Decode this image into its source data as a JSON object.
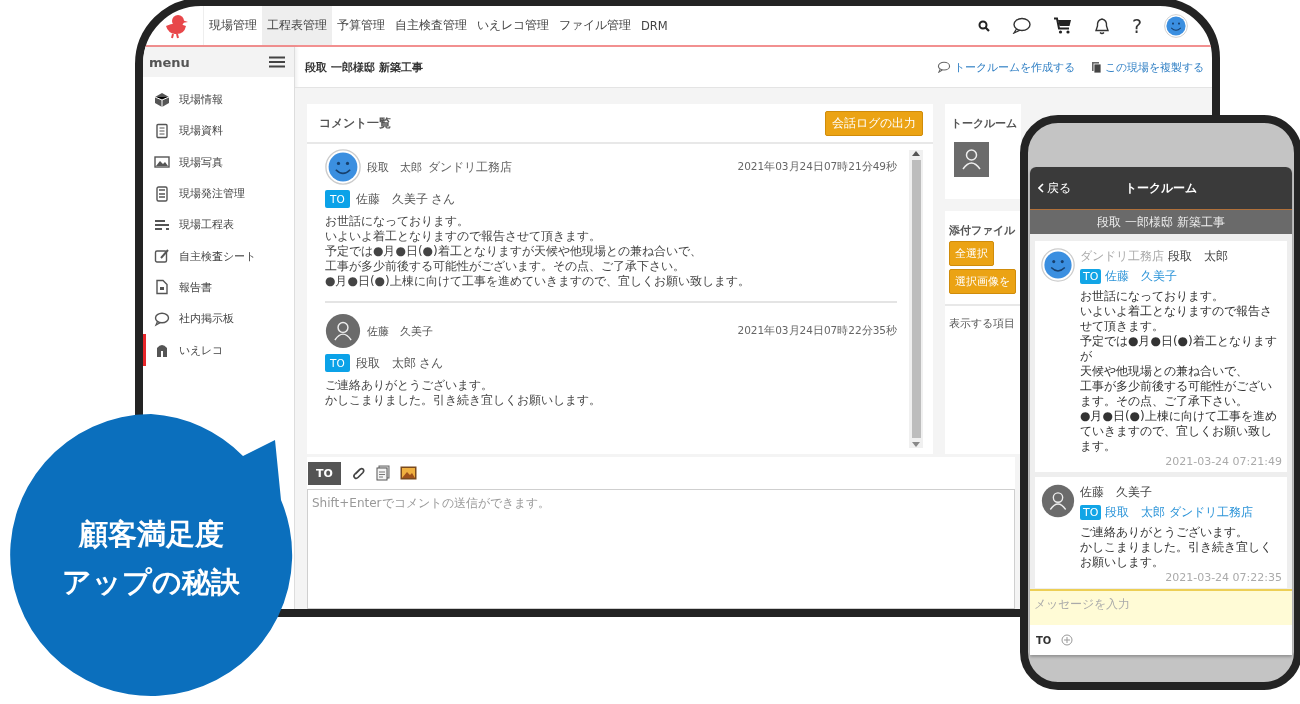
{
  "nav": {
    "items": [
      {
        "label": "現場管理",
        "selected": false
      },
      {
        "label": "工程表管理",
        "selected": true
      },
      {
        "label": "予算管理",
        "selected": false
      },
      {
        "label": "自主検査管理",
        "selected": false
      },
      {
        "label": "いえレコ管理",
        "selected": false
      },
      {
        "label": "ファイル管理",
        "selected": false
      },
      {
        "label": "DRM",
        "selected": false
      }
    ],
    "help": "?"
  },
  "sidebar": {
    "title": "menu",
    "items": [
      {
        "label": "現場情報",
        "selected": false
      },
      {
        "label": "現場資料",
        "selected": false
      },
      {
        "label": "現場写真",
        "selected": false
      },
      {
        "label": "現場発注管理",
        "selected": false
      },
      {
        "label": "現場工程表",
        "selected": false
      },
      {
        "label": "自主検査シート",
        "selected": false
      },
      {
        "label": "報告書",
        "selected": false
      },
      {
        "label": "社内掲示板",
        "selected": false
      },
      {
        "label": "いえレコ",
        "selected": true
      }
    ]
  },
  "page": {
    "title": "段取 一郎様邸 新築工事",
    "actions": [
      "トークルームを作成する",
      "この現場を複製する"
    ]
  },
  "comments": {
    "title": "コメント一覧",
    "export_button": "会話ログの出力",
    "items": [
      {
        "kind": "custom_avatar",
        "author": "段取　太郎",
        "company": "ダンドリ工務店",
        "date": "2021年03月24日07時21分49秒",
        "to_badge": "TO",
        "recipient": "佐藤　久美子 さん",
        "lines": [
          "お世話になっております。",
          "いよいよ着工となりますので報告させて頂きます。",
          "予定では●月●日(●)着工となりますが天候や他現場との兼ね合いで、",
          "工事が多少前後する可能性がございます。その点、ご了承下さい。",
          "●月●日(●)上棟に向けて工事を進めていきますので、宜しくお願い致します。"
        ]
      },
      {
        "kind": "default_avatar",
        "author": "佐藤　久美子",
        "date": "2021年03月24日07時22分35秒",
        "to_badge": "TO",
        "recipient": "段取　太郎 さん",
        "lines": [
          "ご連絡ありがとうございます。",
          "かしこまりました。引き続き宜しくお願いします。"
        ]
      }
    ]
  },
  "side_panel": {
    "members_title": "トークルーム",
    "files_title": "添付ファイル",
    "buttons": [
      "全選択",
      "選択画像を"
    ],
    "display_label": "表示する項目"
  },
  "composer": {
    "to_button": "TO",
    "placeholder": "Shift+Enterでコメントの送信ができます。"
  },
  "phone": {
    "back": "戻る",
    "title": "トークルーム",
    "subtitle": "段取 一郎様邸 新築工事",
    "messages": [
      {
        "kind": "custom_avatar",
        "company": "ダンドリ工務店",
        "author": "段取　太郎",
        "to_badge": "TO",
        "recipient": "佐藤　久美子",
        "lines": [
          "お世話になっております。",
          "いよいよ着工となりますので報告させて頂きます。",
          "予定では●月●日(●)着工となりますが",
          "天候や他現場との兼ね合いで、",
          "工事が多少前後する可能性がございます。その点、ご了承下さい。",
          "●月●日(●)上棟に向けて工事を進めていきますので、宜しくお願い致します。"
        ],
        "time": "2021-03-24 07:21:49"
      },
      {
        "kind": "default_avatar",
        "author": "佐藤　久美子",
        "to_badge": "TO",
        "recipient": "段取　太郎",
        "recipient_company": "ダンドリ工務店",
        "lines": [
          "ご連絡ありがとうございます。",
          "かしこまりました。引き続き宜しくお願いします。"
        ],
        "time": "2021-03-24 07:22:35"
      }
    ],
    "placeholder": "メッセージを入力",
    "to_label": "TO"
  },
  "callout": {
    "lines": [
      "顧客満足度",
      "アップの秘訣"
    ]
  }
}
